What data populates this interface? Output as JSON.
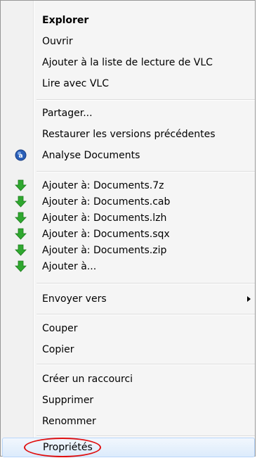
{
  "menu": {
    "group1": [
      {
        "label": "Explorer",
        "bold": true
      },
      {
        "label": "Ouvrir"
      },
      {
        "label": "Ajouter à la liste de lecture de VLC"
      },
      {
        "label": "Lire avec VLC"
      }
    ],
    "group2": [
      {
        "label": "Partager..."
      },
      {
        "label": "Restaurer les versions précédentes"
      },
      {
        "label": "Analyse Documents",
        "icon": "antivirus-shield-icon"
      }
    ],
    "group3": [
      {
        "label": "Ajouter à: Documents.7z",
        "icon": "green-down-arrow-icon"
      },
      {
        "label": "Ajouter à: Documents.cab",
        "icon": "green-down-arrow-icon"
      },
      {
        "label": "Ajouter à: Documents.lzh",
        "icon": "green-down-arrow-icon"
      },
      {
        "label": "Ajouter à: Documents.sqx",
        "icon": "green-down-arrow-icon"
      },
      {
        "label": "Ajouter à: Documents.zip",
        "icon": "green-down-arrow-icon"
      },
      {
        "label": "Ajouter à...",
        "icon": "green-down-arrow-icon"
      }
    ],
    "group4": [
      {
        "label": "Envoyer vers",
        "submenu": true
      }
    ],
    "group5": [
      {
        "label": "Couper"
      },
      {
        "label": "Copier"
      }
    ],
    "group6": [
      {
        "label": "Créer un raccourci"
      },
      {
        "label": "Supprimer"
      },
      {
        "label": "Renommer"
      }
    ],
    "group7": [
      {
        "label": "Propriétés",
        "highlighted": true
      }
    ]
  },
  "colors": {
    "annotation": "#e01010",
    "icon_green": "#2fa82f",
    "icon_blue": "#2a5fb8"
  }
}
